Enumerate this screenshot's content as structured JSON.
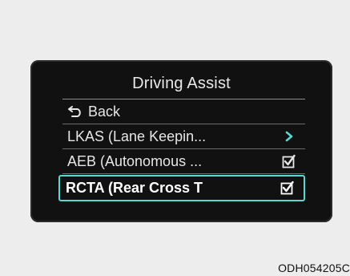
{
  "screen": {
    "title": "Driving Assist",
    "menu_items": [
      {
        "label": "Back",
        "icon": "back-arrow-icon",
        "state": "none"
      },
      {
        "label": "LKAS (Lane Keepin...",
        "icon": "chevron-right-icon",
        "state": "submenu"
      },
      {
        "label": "AEB (Autonomous ...",
        "icon": "checkbox-checked-icon",
        "state": "checked"
      },
      {
        "label": "RCTA (Rear Cross T",
        "icon": "checkbox-checked-icon",
        "state": "checked",
        "selected": true
      }
    ],
    "colors": {
      "screen_bg": "#111111",
      "text": "#e6e6e6",
      "accent_selection": "#58d9d2"
    }
  },
  "figure_code": "ODH054205C"
}
